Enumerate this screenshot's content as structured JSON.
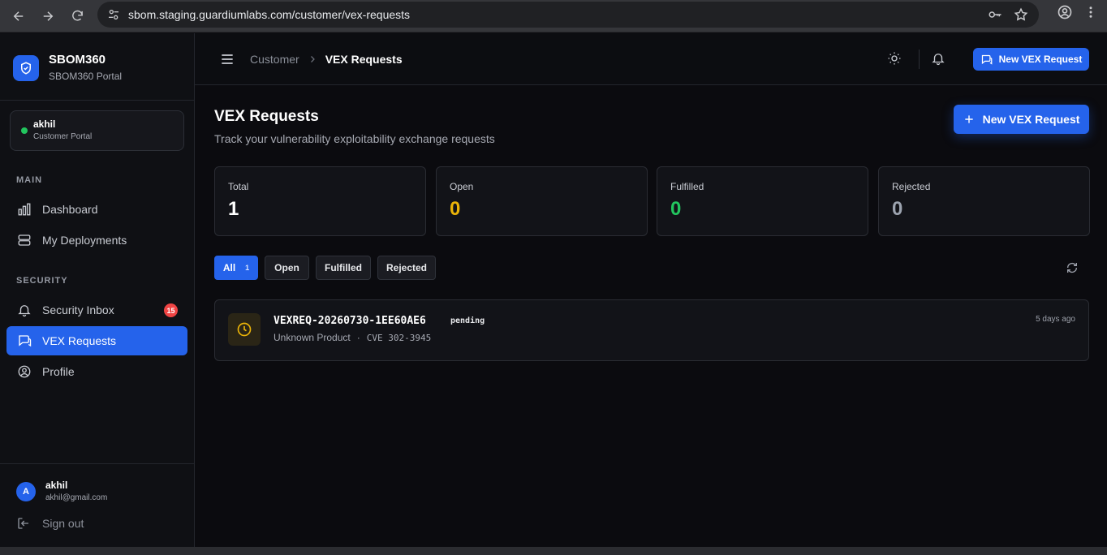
{
  "browser": {
    "url": "sbom.staging.guardiumlabs.com/customer/vex-requests",
    "icons": [
      "arrow-left-icon",
      "arrow-right-icon",
      "reload-icon",
      "site-settings-icon",
      "key-icon",
      "star-icon",
      "profile-icon",
      "more-vert-icon"
    ]
  },
  "sidebar": {
    "brand": {
      "name": "SBOM360",
      "subtitle": "SBOM360 Portal",
      "icon": "shield-check-icon"
    },
    "user_card": {
      "name": "akhil",
      "role": "Customer Portal",
      "status_color": "#22c55e"
    },
    "sections": [
      {
        "label": "MAIN",
        "items": [
          {
            "label": "Dashboard",
            "icon": "bar-chart-icon"
          },
          {
            "label": "My Deployments",
            "icon": "server-icon"
          }
        ]
      },
      {
        "label": "SECURITY",
        "items": [
          {
            "label": "Security Inbox",
            "icon": "bell-icon",
            "badge": "15"
          },
          {
            "label": "VEX Requests",
            "icon": "message-square-icon",
            "active": true
          },
          {
            "label": "Profile",
            "icon": "user-circle-icon"
          }
        ]
      }
    ],
    "footer": {
      "avatar": "A",
      "name": "akhil",
      "email": "akhil@gmail.com",
      "signout": "Sign out"
    }
  },
  "header": {
    "breadcrumb": {
      "parent": "Customer",
      "current": "VEX Requests"
    },
    "button": "New VEX Request"
  },
  "main": {
    "title": "VEX Requests",
    "subtitle": "Track your vulnerability exploitability exchange requests",
    "new_button": "New VEX Request",
    "stats": [
      {
        "label": "Total",
        "value": "1",
        "color": "#ffffff"
      },
      {
        "label": "Open",
        "value": "0",
        "color": "#eab308"
      },
      {
        "label": "Fulfilled",
        "value": "0",
        "color": "#22c55e"
      },
      {
        "label": "Rejected",
        "value": "0",
        "color": "#9ca3af"
      }
    ],
    "filters": [
      {
        "label": "All",
        "count": "1",
        "active": true
      },
      {
        "label": "Open"
      },
      {
        "label": "Fulfilled"
      },
      {
        "label": "Rejected"
      }
    ],
    "requests": [
      {
        "id": "VEXREQ-20260730-1EE60AE6",
        "status": "pending",
        "product": "Unknown Product",
        "separator": "·",
        "cve": "CVE 302-3945",
        "time": "5 days ago"
      }
    ]
  },
  "colors": {
    "accent": "#2563eb",
    "badge": "#ef4444",
    "pending": "#eab308"
  }
}
